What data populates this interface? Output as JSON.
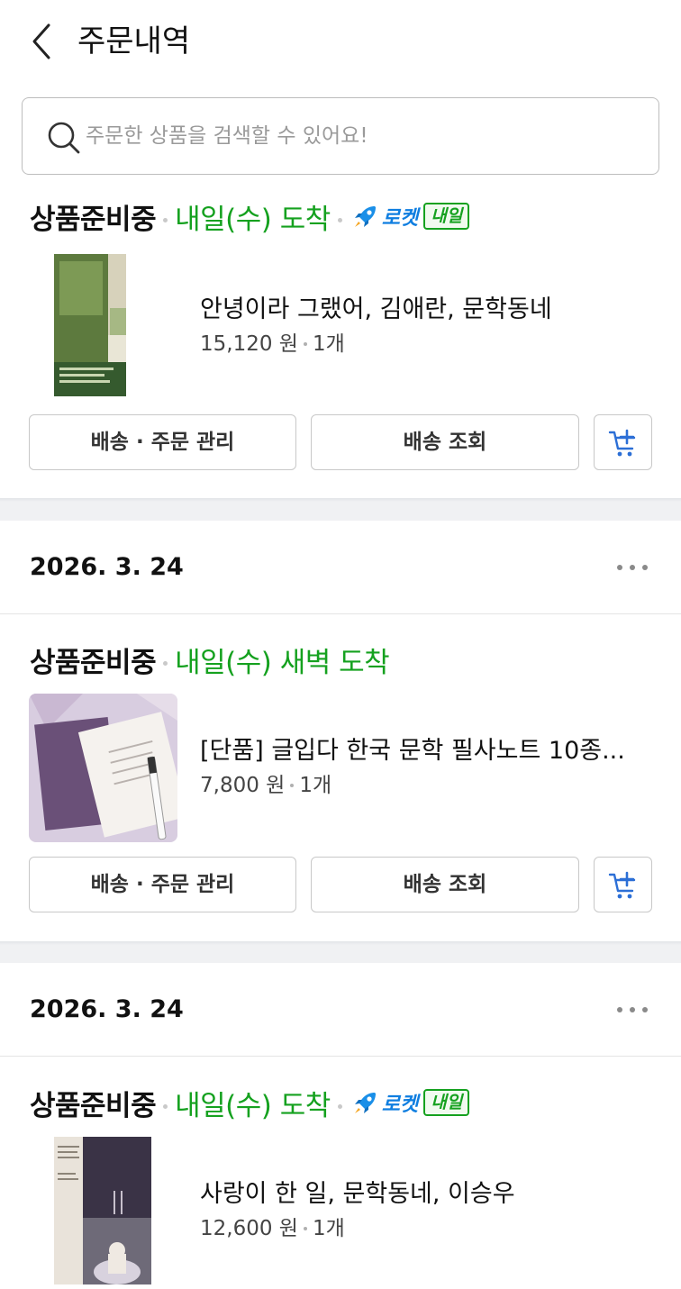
{
  "header": {
    "title": "주문내역",
    "back_icon": "chevron-left-icon"
  },
  "search": {
    "placeholder": "주문한 상품을 검색할 수 있어요!",
    "icon": "search-icon"
  },
  "colors": {
    "arrival_green": "#15a11f",
    "rocket_blue": "#0f7ee0",
    "cart_blue": "#2c6fd6",
    "divider_gray": "#f0f1f3"
  },
  "orders": [
    {
      "date": "",
      "status": "상품준비중",
      "arrival": "내일(수) 도착",
      "rocket_label": "로켓",
      "rocket_badge": "내일",
      "product_name": "안녕이라 그랬어, 김애란, 문학동네",
      "price": "15,120 원",
      "quantity": "1개",
      "buttons": {
        "manage": "배송 · 주문 관리",
        "track": "배송 조회"
      }
    },
    {
      "date": "2026. 3. 24",
      "status": "상품준비중",
      "arrival": "내일(수) 새벽 도착",
      "product_name": "[단품] 글입다 한국 문학 필사노트 10종...",
      "price": "7,800 원",
      "quantity": "1개",
      "buttons": {
        "manage": "배송 · 주문 관리",
        "track": "배송 조회"
      }
    },
    {
      "date": "2026. 3. 24",
      "status": "상품준비중",
      "arrival": "내일(수) 도착",
      "rocket_label": "로켓",
      "rocket_badge": "내일",
      "product_name": "사랑이 한 일, 문학동네, 이승우",
      "price": "12,600 원",
      "quantity": "1개"
    }
  ]
}
